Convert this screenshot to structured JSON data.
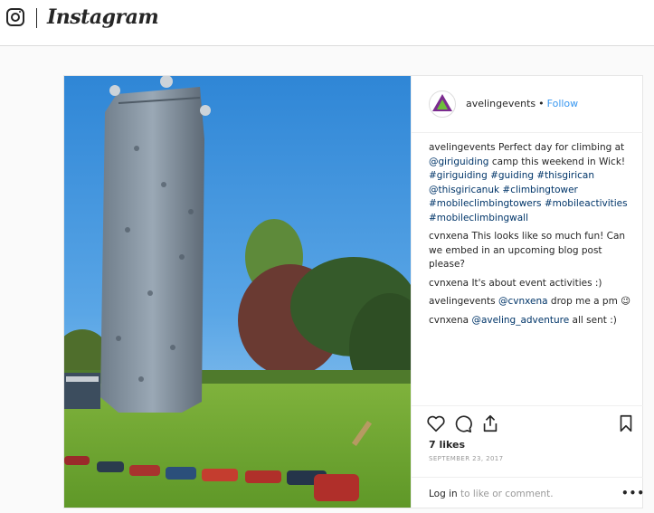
{
  "topbar": {
    "wordmark": "Instagram"
  },
  "post": {
    "username": "avelingevents",
    "separator": "•",
    "follow_label": "Follow",
    "caption": {
      "user": "avelingevents",
      "text": "Perfect day for climbing at",
      "mention": "@giriguiding",
      "text2": "camp this weekend in Wick!",
      "hashtags1": "#giriguiding #guiding #thisgirican",
      "hashtags2": "@thisgiricanuk #climbingtower",
      "hashtags3": "#mobileclimbingtowers #mobileactivities",
      "hashtags4": "#mobileclimbingwall"
    },
    "comments": [
      {
        "user": "cvnxena",
        "text": "This looks like so much fun! Can we embed in an upcoming blog post please?"
      },
      {
        "user": "cvnxena",
        "text": "It's about event activities :)"
      },
      {
        "user": "avelingevents",
        "mention": "@cvnxena",
        "text": "drop me a pm 😉"
      },
      {
        "user": "cvnxena",
        "mention": "@aveling_adventure",
        "text": "all sent :)"
      }
    ],
    "likes": "7 likes",
    "date": "SEPTEMBER 23, 2017",
    "login_link": "Log in",
    "login_text": "to like or comment.",
    "more_label": "•••"
  },
  "icons": [
    "instagram-glyph-icon",
    "heart-icon",
    "comment-icon",
    "share-icon",
    "bookmark-icon",
    "more-icon"
  ]
}
